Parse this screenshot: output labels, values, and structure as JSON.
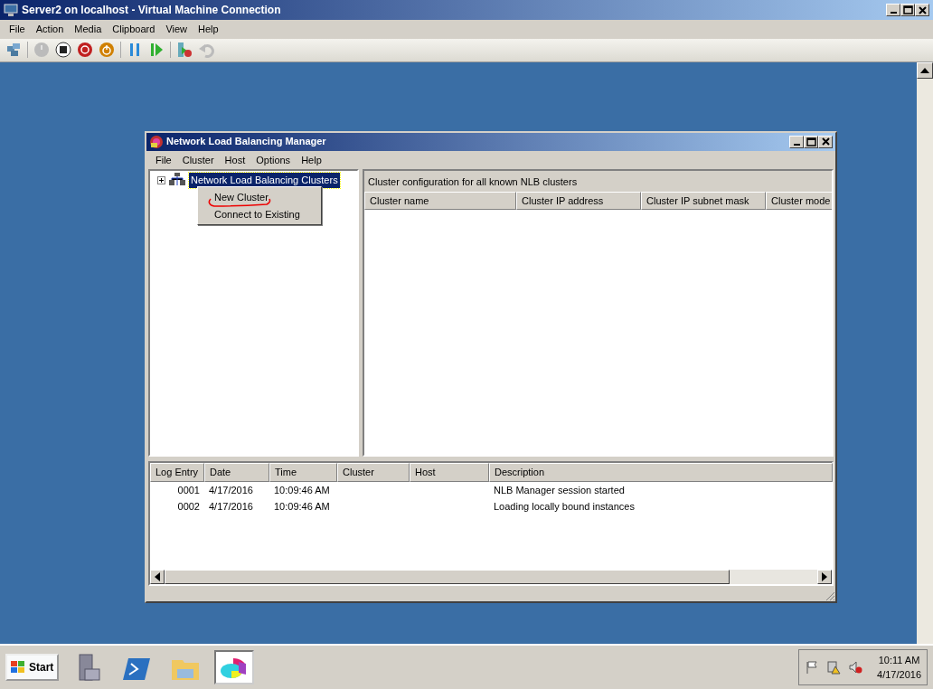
{
  "window": {
    "title": "Server2 on localhost - Virtual Machine Connection"
  },
  "menu": [
    "File",
    "Action",
    "Media",
    "Clipboard",
    "View",
    "Help"
  ],
  "nlb_window": {
    "title": "Network Load Balancing Manager",
    "menu": [
      "File",
      "Cluster",
      "Host",
      "Options",
      "Help"
    ],
    "tree": [
      {
        "label": "Network Load Balancing Clusters",
        "expanded": false,
        "selected": true
      }
    ],
    "context_menu": [
      {
        "label": "New Cluster"
      },
      {
        "label": "Connect to Existing"
      }
    ],
    "right_panel": {
      "heading": "Cluster configuration for all known NLB clusters",
      "columns": [
        "Cluster name",
        "Cluster IP address",
        "Cluster IP subnet mask",
        "Cluster mode"
      ]
    },
    "log": {
      "columns": [
        "Log Entry",
        "Date",
        "Time",
        "Cluster",
        "Host",
        "Description"
      ],
      "rows": [
        [
          "0001",
          "4/17/2016",
          "10:09:46 AM",
          "",
          "",
          "NLB Manager session started"
        ],
        [
          "0002",
          "4/17/2016",
          "10:09:46 AM",
          "",
          "",
          "Loading locally bound instances"
        ]
      ]
    }
  },
  "taskbar": {
    "start": "Start",
    "clock": {
      "time": "10:11 AM",
      "date": "4/17/2016"
    }
  }
}
